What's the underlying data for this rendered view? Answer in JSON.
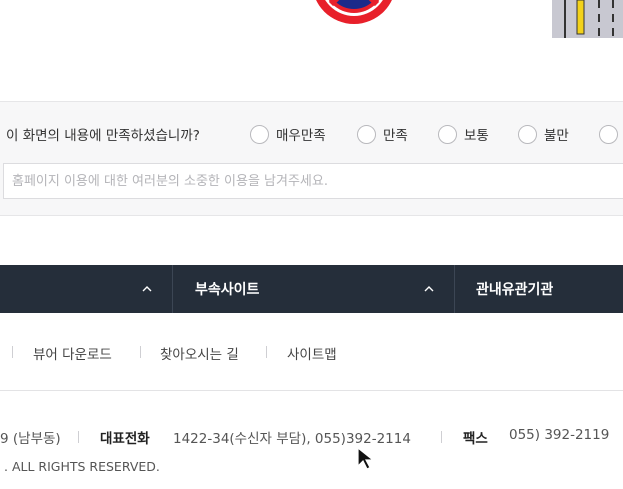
{
  "survey": {
    "question": "이 화면의 내용에 만족하셨습니까?",
    "options": [
      "매우만족",
      "만족",
      "보통",
      "불만"
    ],
    "placeholder": "홈페이지 이용에 대한 여러분의 소중한 이용을 남겨주세요."
  },
  "navbar": {
    "items": [
      {
        "label": "부속사이트"
      },
      {
        "label": "관내유관기관"
      }
    ]
  },
  "footer_links": [
    "뷰어 다운로드",
    "찾아오시는 길",
    "사이트맵"
  ],
  "contact": {
    "address_fragment": "9 (남부동)",
    "phone_label": "대표전화",
    "phone_value": "1422-34(수신자 부담), 055)392-2114",
    "fax_label": "팩스",
    "fax_value": "055) 392-2119",
    "copyright": ". ALL RIGHTS RESERVED."
  },
  "colors": {
    "navbar_bg": "#252e3a",
    "survey_bg": "#f7f7f8"
  }
}
